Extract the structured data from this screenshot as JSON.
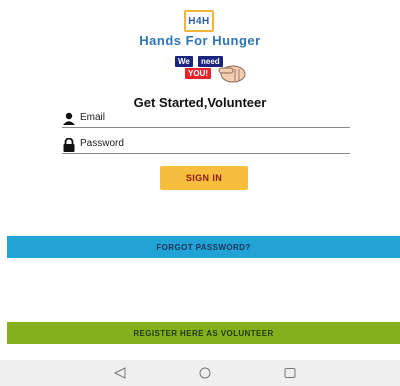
{
  "app": {
    "logo_text": "H4H",
    "brand_name": "Hands For Hunger",
    "badge_words": [
      "We",
      "need",
      "YOU!"
    ]
  },
  "form": {
    "heading": "Get Started,Volunteer",
    "email_placeholder": "Email",
    "password_placeholder": "Password",
    "signin_label": "SIGN IN"
  },
  "actions": {
    "forgot_label": "FORGOT PASSWORD?",
    "register_label": "REGISTER HERE AS VOLUNTEER"
  },
  "navbar": {
    "icons": [
      "back-icon",
      "home-icon",
      "recents-icon"
    ]
  },
  "colors": {
    "accent_yellow": "#f6be3c",
    "brand_blue": "#2f74b5",
    "forgot_bar": "#21a3d6",
    "register_bar": "#84b01d"
  }
}
